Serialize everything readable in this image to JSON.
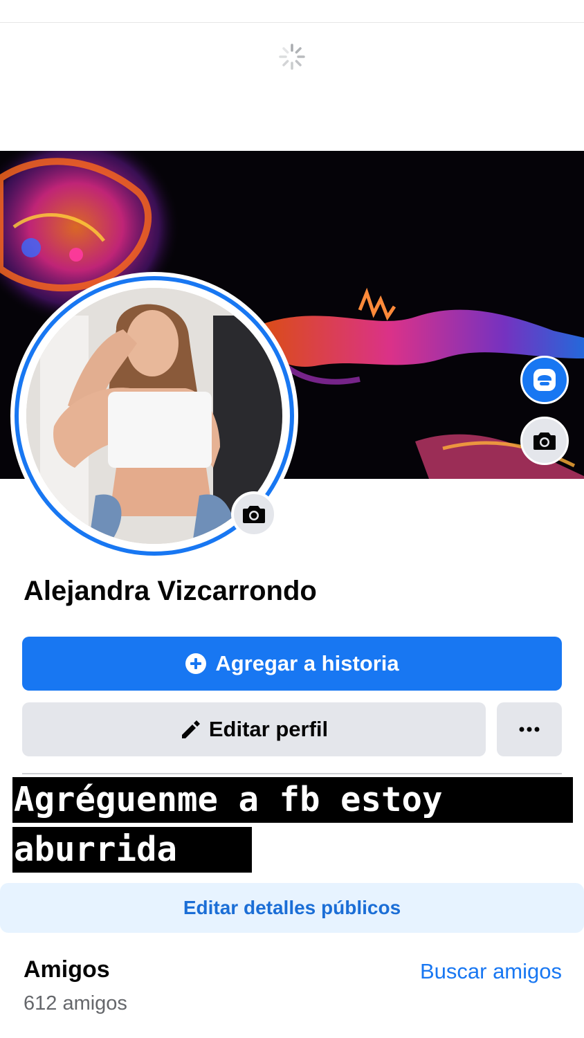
{
  "profile": {
    "name": "Alejandra Vizcarrondo"
  },
  "actions": {
    "add_story": "Agregar a historia",
    "edit_profile": "Editar perfil",
    "edit_public_details": "Editar detalles públicos"
  },
  "caption": {
    "line1": "Agréguenme a fb estoy",
    "line2": "aburrida"
  },
  "friends": {
    "title": "Amigos",
    "count": "612 amigos",
    "find": "Buscar amigos"
  },
  "colors": {
    "accent": "#1877f2",
    "button_gray": "#e4e6eb",
    "details_bg": "#e7f3ff"
  },
  "icons": [
    "loading-spinner-icon",
    "camera-icon",
    "avatar-icon",
    "plus-circle-icon",
    "pencil-icon",
    "more-dots-icon"
  ]
}
